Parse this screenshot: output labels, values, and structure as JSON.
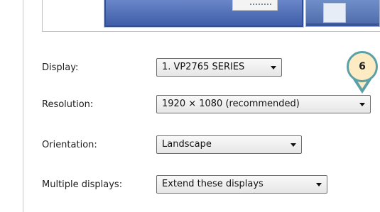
{
  "display_settings": {
    "display": {
      "label": "Display:",
      "value": "1. VP2765 SERIES"
    },
    "resolution": {
      "label": "Resolution:",
      "value": "1920 × 1080 (recommended)"
    },
    "orientation": {
      "label": "Orientation:",
      "value": "Landscape"
    },
    "multiple_displays": {
      "label": "Multiple displays:",
      "value": "Extend these displays"
    }
  },
  "callout": {
    "number": "6",
    "color": "#5aa0a6",
    "fill": "#fdecc3"
  },
  "monitor_preview": {
    "selected_color": "#3f5ea8",
    "secondary_color": "#6f8fc9"
  }
}
